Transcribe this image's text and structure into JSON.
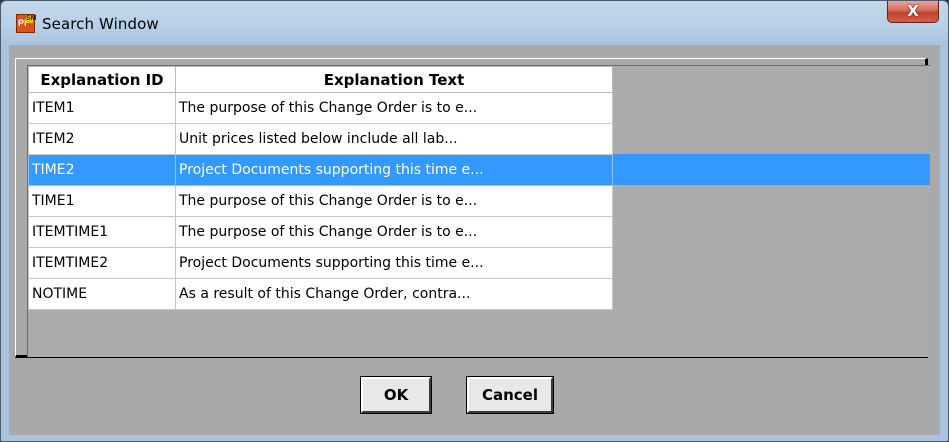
{
  "window": {
    "title": "Search Window",
    "close_glyph": "X",
    "icon": {
      "label_left": "Pi",
      "label_right": "SM",
      "semantic": "primavera-app-icon"
    }
  },
  "grid": {
    "columns": [
      "Explanation ID",
      "Explanation Text"
    ],
    "selected_index": 2,
    "rows": [
      {
        "id": "ITEM1",
        "text": "The purpose of this Change Order is to e..."
      },
      {
        "id": "ITEM2",
        "text": "Unit prices listed below include all lab..."
      },
      {
        "id": "TIME2",
        "text": "Project Documents supporting this time e..."
      },
      {
        "id": "TIME1",
        "text": "The purpose of this Change Order is to e..."
      },
      {
        "id": "ITEMTIME1",
        "text": "The purpose of this Change Order is to e..."
      },
      {
        "id": "ITEMTIME2",
        "text": "Project Documents supporting this time e..."
      },
      {
        "id": "NOTIME",
        "text": "As a result of this Change Order, contra..."
      }
    ]
  },
  "buttons": {
    "ok": "OK",
    "cancel": "Cancel"
  },
  "colors": {
    "selection": "#3399ff",
    "client_background": "#a9a9a9",
    "close_button": "#c3402c"
  }
}
